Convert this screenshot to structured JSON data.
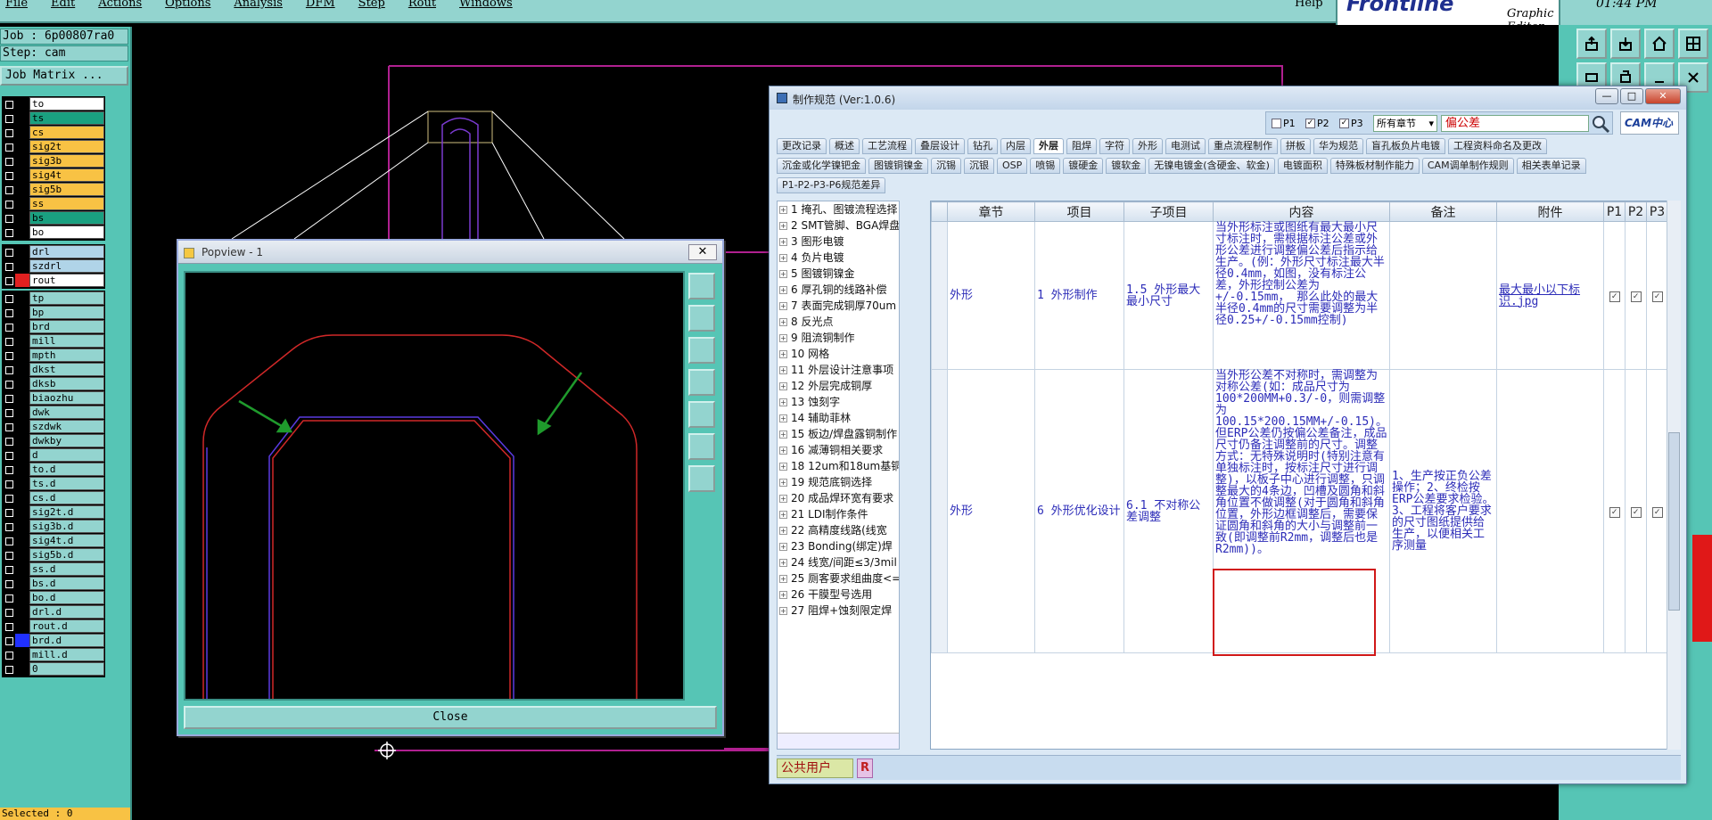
{
  "menubar": {
    "items": [
      "File",
      "Edit",
      "Actions",
      "Options",
      "Analysis",
      "DFM",
      "Step",
      "Rout",
      "Windows"
    ],
    "help": "Help"
  },
  "brand": {
    "logo": "Frontline",
    "subtitle": "Graphic Editor"
  },
  "clock": "01:44 PM",
  "job": {
    "job_label": "Job : 6p00807ra0",
    "step_label": "Step: cam",
    "matrix_button": "Job Matrix ..."
  },
  "layers_board": [
    {
      "name": "to",
      "color": "#ffffff"
    },
    {
      "name": "ts",
      "color": "#1aa080"
    },
    {
      "name": "cs",
      "color": "#f8c244"
    },
    {
      "name": "sig2t",
      "color": "#f8c244"
    },
    {
      "name": "sig3b",
      "color": "#f8c244"
    },
    {
      "name": "sig4t",
      "color": "#f8c244"
    },
    {
      "name": "sig5b",
      "color": "#f8c244"
    },
    {
      "name": "ss",
      "color": "#f8c244"
    },
    {
      "name": "bs",
      "color": "#1aa080"
    },
    {
      "name": "bo",
      "color": "#ffffff"
    }
  ],
  "layers_drill": [
    {
      "name": "drl",
      "color": "#b0d4e8"
    },
    {
      "name": "szdrl",
      "color": "#b0d4e8"
    },
    {
      "name": "rout",
      "color": "#ffffff",
      "swatch": "#e02020"
    }
  ],
  "layers_misc": [
    {
      "name": "tp"
    },
    {
      "name": "bp"
    },
    {
      "name": "brd"
    },
    {
      "name": "mill"
    },
    {
      "name": "mpth"
    },
    {
      "name": "dkst"
    },
    {
      "name": "dksb"
    },
    {
      "name": "biaozhu"
    },
    {
      "name": "dwk"
    },
    {
      "name": "szdwk"
    },
    {
      "name": "dwkby"
    },
    {
      "name": "d"
    },
    {
      "name": "to.d"
    },
    {
      "name": "ts.d"
    },
    {
      "name": "cs.d"
    },
    {
      "name": "sig2t.d"
    },
    {
      "name": "sig3b.d"
    },
    {
      "name": "sig4t.d"
    },
    {
      "name": "sig5b.d"
    },
    {
      "name": "ss.d"
    },
    {
      "name": "bs.d"
    },
    {
      "name": "bo.d"
    },
    {
      "name": "drl.d"
    },
    {
      "name": "rout.d"
    },
    {
      "name": "brd.d",
      "swatch": "#2030ff"
    },
    {
      "name": "mill.d"
    },
    {
      "name": "0"
    }
  ],
  "status": {
    "selected": "Selected : 0"
  },
  "popview": {
    "title": "Popview - 1",
    "close_x": "✕",
    "close_button": "Close"
  },
  "spec": {
    "title": "制作规范 (Ver:1.0.6)",
    "filters": [
      {
        "label": "P1",
        "checked": false
      },
      {
        "label": "P2",
        "checked": true
      },
      {
        "label": "P3",
        "checked": true
      }
    ],
    "chapter_select": "所有章节",
    "search_value": "偏公差",
    "cam_logo": "CAM中心",
    "tabs_row1": [
      "更改记录",
      "概述",
      "工艺流程",
      "叠层设计",
      "钻孔",
      "内层",
      "外层",
      "阻焊",
      "字符",
      "外形",
      "电测试",
      "重点流程制作",
      "拼板",
      "华为规范",
      "盲孔板负片电镀",
      "工程资料命名及更改"
    ],
    "active_tab": "外层",
    "tabs_row2": [
      "沉金或化学镍钯金",
      "图镀铜镍金",
      "沉锡",
      "沉银",
      "OSP",
      "喷锡",
      "镀硬金",
      "镀软金",
      "无镍电镀金(含硬金、软金)",
      "电镀面积",
      "特殊板材制作能力",
      "CAM调单制作规则",
      "相关表单记录"
    ],
    "tabs_row3": [
      "P1-P2-P3-P6规范差异"
    ],
    "tree": [
      "1 掩孔、图镀流程选择",
      "2 SMT管脚、BGA焊盘",
      "3 图形电镀",
      "4 负片电镀",
      "5 图镀铜镍金",
      "6 厚孔铜的线路补偿",
      "7 表面完成铜厚70um",
      "8 反光点",
      "9 阻流铜制作",
      "10 网格",
      "11 外层设计注意事项",
      "12 外层完成铜厚",
      "13 蚀刻字",
      "14 辅助菲林",
      "15 板边/焊盘露铜制作",
      "16 减薄铜相关要求",
      "18 12um和18um基铜工",
      "19 规范底铜选择",
      "20 成品焊环宽有要求",
      "21 LDI制作条件",
      "22 高精度线路(线宽",
      "23 Bonding(绑定)焊",
      "24 线宽/间距≤3/3mil",
      "25 厕客要求组曲度<=",
      "26 干膜型号选用",
      "27 阻焊+蚀刻限定焊"
    ],
    "columns": [
      "章节",
      "项目",
      "子项目",
      "内容",
      "备注",
      "附件",
      "P1",
      "P2",
      "P3"
    ],
    "rows": [
      {
        "chapter": "外形",
        "item": "1 外形制作",
        "subitem": "1.5 外形最大最小尺寸",
        "content": "当外形标注或图纸有最大最小尺寸标注时，需根据标注公差或外形公差进行调整偏公差后指示给生产。(例：外形尺寸标注最大半径0.4mm，如图，没有标注公差，外形控制公差为+/-0.15mm， 那么此处的最大半径0.4mm的尺寸需要调整为半径0.25+/-0.15mm控制)",
        "note": "",
        "attachment": "最大最小以下标识.jpg",
        "p": [
          "✓",
          "✓",
          "✓"
        ]
      },
      {
        "chapter": "外形",
        "item": "6 外形优化设计",
        "subitem": "6.1 不对称公差调整",
        "content": "当外形公差不对称时，需调整为对称公差(如：成品尺寸为100*200MM+0.3/-0，则需调整为100.15*200.15MM+/-0.15)。但ERP公差仍按偏公差备注，成品尺寸仍备注调整前的尺寸。调整方式：无特殊说明时(特别注意有单独标注时，按标注尺寸进行调整)，以板子中心进行调整，只调整最大的4条边，凹槽及圆角和斜角位置不做调整(对于圆角和斜角位置，外形边框调整后，需要保证圆角和斜角的大小与调整前一致(即调整前R2mm，调整后也是R2mm))。",
        "note": "1、生产按正负公差操作；2、终检按ERP公差要求检验。3、工程将客户要求的尺寸图纸提供给生产，以便相关工序测量",
        "attachment": "",
        "p": [
          "✓",
          "✓",
          "✓"
        ]
      }
    ],
    "footer_user": "公共用户",
    "footer_r": "R"
  },
  "accent_colors": {
    "teal_panel": "#56c5b5",
    "highlight_red": "#d01818",
    "arrow_green": "#1f9a2c"
  }
}
